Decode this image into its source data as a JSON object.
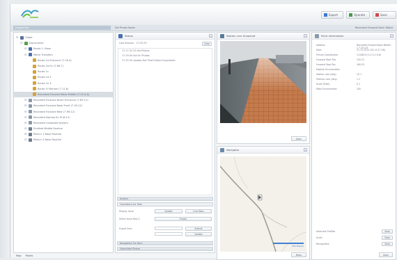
{
  "header": {
    "buttons": [
      {
        "label": "Export",
        "color": "#3a7bd5"
      },
      {
        "label": "Operate",
        "color": "#4a9a4a"
      },
      {
        "label": "Save",
        "color": "#d04848"
      }
    ]
  },
  "subbar": {
    "tab_label": "Dispatcher",
    "mid_label": "Set Photo Route",
    "right_label": "Recorded Forward Back Tablet"
  },
  "tree": {
    "items": [
      {
        "label": "Globe",
        "level": 0,
        "color": "#5a6ea0"
      },
      {
        "label": "Documents",
        "level": 1,
        "color": "#5b9e4a"
      },
      {
        "label": "Route 1: Base",
        "level": 2,
        "color": "#4a6fb0"
      },
      {
        "label": "Metro Transfers",
        "level": 2,
        "color": "#4a6fb0"
      },
      {
        "label": "Route 1a Entrance (7.16.4)",
        "level": 3,
        "color": "#d5a13a"
      },
      {
        "label": "Route 1b Ex (7.88.7)",
        "level": 3,
        "color": "#d5a13a"
      },
      {
        "label": "Route 1c",
        "level": 3,
        "color": "#d5a13a"
      },
      {
        "label": "Route 1d 2",
        "level": 3,
        "color": "#d5a13a"
      },
      {
        "label": "Route 1e 3",
        "level": 3,
        "color": "#d5a13a"
      },
      {
        "label": "Route 1f Narrow (7.11.6)",
        "level": 3,
        "color": "#d5a13a"
      },
      {
        "label": "Recorded Forward Base Middle (7.25.4.8)",
        "level": 3,
        "color": "#d5a13a",
        "selected": true
      },
      {
        "label": "Recorded Forward North Entrance (7.89.12)",
        "level": 2,
        "color": "#8a9aaa"
      },
      {
        "label": "Recorded Forward Base Front (7.29.12)",
        "level": 2,
        "color": "#8a9aaa"
      },
      {
        "label": "Recorded Forward Rear (7.96.12)",
        "level": 2,
        "color": "#8a9aaa"
      },
      {
        "label": "Recorded Narrow Ex M (8.12)",
        "level": 2,
        "color": "#8a9aaa"
      },
      {
        "label": "Recorded Unloaded Sectors",
        "level": 2,
        "color": "#8a9aaa"
      },
      {
        "label": "Emitted Middle Routine",
        "level": 2,
        "color": "#6f7f8f"
      },
      {
        "label": "Return 1 Base Routine",
        "level": 2,
        "color": "#6f7f8f"
      },
      {
        "label": "Return 2 Base Routine",
        "level": 2,
        "color": "#6f7f8f"
      }
    ],
    "bottom_tabs": [
      "Map",
      "Points"
    ]
  },
  "log_panel": {
    "title": "Status",
    "header_text": "Last Session - 17:32:29",
    "clear_label": "Clear",
    "lines": [
      "17.17.32 29 Aid Photos",
      "17.29.00 Aid Un Photos",
      "17.29.30 Update Dat Phot Editors Exportable"
    ],
    "section1": "Actions",
    "section2": "Operations for Item",
    "rows": [
      {
        "label": "Display Issue",
        "btn1": "Update",
        "btn2": "Live Data"
      },
      {
        "label": "Select Issue Row 2",
        "btn1": "Empty",
        "btn2": ""
      },
      {
        "label": "Export Item",
        "btn1": "",
        "btn2": "Submit"
      },
      {
        "label": "",
        "btn1": "",
        "btn2": "Update"
      }
    ],
    "section3": "Navigation For Item",
    "section4": "Submitted Photos"
  },
  "photo_panel": {
    "title": "Station Live Snapshot",
    "footer_btn": "Open"
  },
  "map_panel": {
    "title": "Navigator",
    "scale_label": "500 Meters",
    "footer_btn": "Move"
  },
  "info_panel": {
    "title": "Point Information",
    "rows": [
      {
        "k": "Address",
        "v": "Recorded Forward Base Middle 1 7.25.4.8"
      },
      {
        "k": "Date",
        "v": "21.12.2012 (05 11:17:28)"
      },
      {
        "k": "Picture Coordinates",
        "v": "1/1285.6 (1.0 2.1 8.6)"
      },
      {
        "k": "Forward Start Pos",
        "v": "155.31"
      },
      {
        "k": "Forward Stop Pos",
        "v": "160.53"
      },
      {
        "k": "Position Enumeration",
        "v": ""
      },
      {
        "k": "Station cam (deg)",
        "v": "12.1"
      },
      {
        "k": "Position cam (deg)",
        "v": "1.1"
      },
      {
        "k": "Scale (Pixel)",
        "v": "0.1"
      },
      {
        "k": "Ratio Enumeration",
        "v": "100"
      }
    ],
    "bottom_rows": [
      {
        "k": "Alternate Profiles",
        "btn": "View"
      },
      {
        "k": "Scale",
        "btn": "View"
      },
      {
        "k": "Recognition",
        "btn": "View"
      }
    ],
    "footer_btn": "Open"
  }
}
